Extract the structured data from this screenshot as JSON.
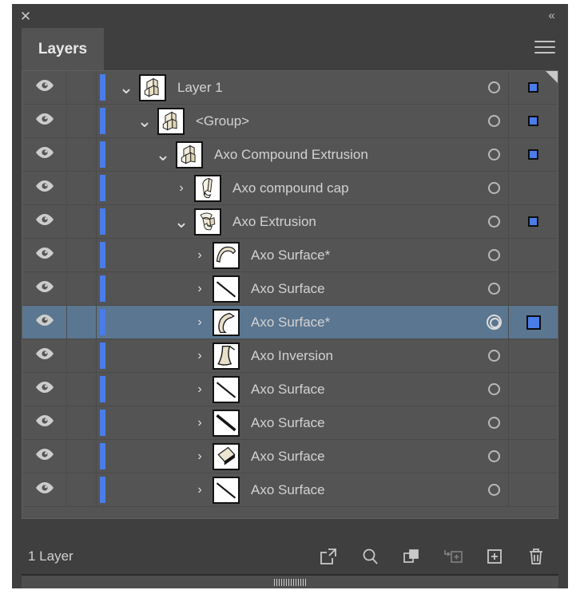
{
  "titlebar": {
    "close_label": "✕",
    "collapse_label": "«"
  },
  "tabs": [
    {
      "label": "Layers",
      "active": true
    }
  ],
  "panel_menu_name": "panel-menu-icon",
  "colors": {
    "panel_bg": "#3f3f3f",
    "list_bg": "#545454",
    "selected_row": "#5b7690",
    "accent_blue": "#4a7dea",
    "text": "#d2d2d2"
  },
  "columns": {
    "visibility": "visibility",
    "lock": "lock",
    "target": "target",
    "selection": "selection"
  },
  "layers": [
    {
      "name": "Layer 1",
      "indent": 0,
      "expanded": true,
      "visible": true,
      "selected": false,
      "has_target_ring": true,
      "has_selection_swatch": true,
      "thumb": "axo-letter-a",
      "corner_marker": true
    },
    {
      "name": "<Group>",
      "indent": 1,
      "expanded": true,
      "visible": true,
      "selected": false,
      "has_target_ring": true,
      "has_selection_swatch": true,
      "thumb": "axo-letter-a",
      "corner_marker": false
    },
    {
      "name": "Axo Compound Extrusion",
      "indent": 2,
      "expanded": true,
      "visible": true,
      "selected": false,
      "has_target_ring": true,
      "has_selection_swatch": true,
      "thumb": "axo-letter-a",
      "corner_marker": false
    },
    {
      "name": "Axo compound cap",
      "indent": 3,
      "expanded": false,
      "visible": true,
      "selected": false,
      "has_target_ring": true,
      "has_selection_swatch": false,
      "thumb": "axo-cap",
      "corner_marker": false
    },
    {
      "name": "Axo Extrusion",
      "indent": 3,
      "expanded": true,
      "visible": true,
      "selected": false,
      "has_target_ring": true,
      "has_selection_swatch": true,
      "thumb": "axo-extrusion",
      "corner_marker": false
    },
    {
      "name": "Axo Surface*",
      "indent": 4,
      "expanded": false,
      "visible": true,
      "selected": false,
      "has_target_ring": true,
      "has_selection_swatch": false,
      "thumb": "surface-curve-top",
      "corner_marker": false
    },
    {
      "name": "Axo Surface",
      "indent": 4,
      "expanded": false,
      "visible": true,
      "selected": false,
      "has_target_ring": true,
      "has_selection_swatch": false,
      "thumb": "surface-diagonal",
      "corner_marker": false
    },
    {
      "name": "Axo Surface*",
      "indent": 4,
      "expanded": false,
      "visible": true,
      "selected": true,
      "has_target_ring": true,
      "has_selection_swatch": true,
      "thumb": "surface-curve-right",
      "corner_marker": false
    },
    {
      "name": "Axo Inversion",
      "indent": 4,
      "expanded": false,
      "visible": true,
      "selected": false,
      "has_target_ring": true,
      "has_selection_swatch": false,
      "thumb": "surface-inversion",
      "corner_marker": false
    },
    {
      "name": "Axo Surface",
      "indent": 4,
      "expanded": false,
      "visible": true,
      "selected": false,
      "has_target_ring": true,
      "has_selection_swatch": false,
      "thumb": "surface-diagonal",
      "corner_marker": false
    },
    {
      "name": "Axo Surface",
      "indent": 4,
      "expanded": false,
      "visible": true,
      "selected": false,
      "has_target_ring": true,
      "has_selection_swatch": false,
      "thumb": "surface-diagonal-thick",
      "corner_marker": false
    },
    {
      "name": "Axo Surface",
      "indent": 4,
      "expanded": false,
      "visible": true,
      "selected": false,
      "has_target_ring": true,
      "has_selection_swatch": false,
      "thumb": "surface-sliver",
      "corner_marker": false
    },
    {
      "name": "Axo Surface",
      "indent": 4,
      "expanded": false,
      "visible": true,
      "selected": false,
      "has_target_ring": true,
      "has_selection_swatch": false,
      "thumb": "surface-diagonal",
      "corner_marker": false
    }
  ],
  "footer": {
    "status": "1 Layer",
    "tools": [
      {
        "name": "release-to-layers-icon",
        "label": "Release to Layers",
        "disabled": false
      },
      {
        "name": "locate-object-icon",
        "label": "Locate Object",
        "disabled": false
      },
      {
        "name": "clipping-mask-icon",
        "label": "Make/Release Clipping Mask",
        "disabled": false
      },
      {
        "name": "new-sublayer-icon",
        "label": "Create New Sublayer",
        "disabled": true
      },
      {
        "name": "new-layer-icon",
        "label": "Create New Layer",
        "disabled": false
      },
      {
        "name": "delete-layer-icon",
        "label": "Delete Selection",
        "disabled": false
      }
    ]
  }
}
